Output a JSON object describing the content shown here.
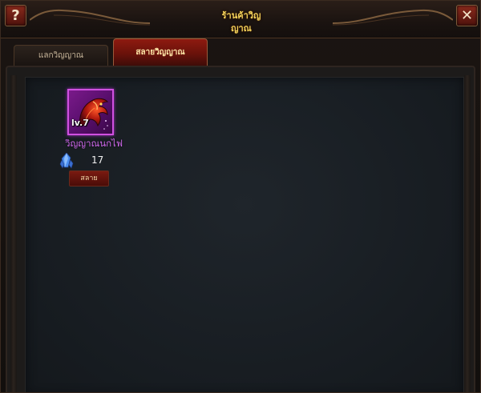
{
  "window": {
    "title_line1": "ร้านค้าวิญ",
    "title_line2": "ญาณ"
  },
  "buttons": {
    "help_icon": "help-icon",
    "help_glyph": "?",
    "close_icon": "close-icon",
    "close_glyph": "✕"
  },
  "tabs": [
    {
      "label": "แลกวิญญาณ",
      "active": false
    },
    {
      "label": "สลายวิญญาณ",
      "active": true
    }
  ],
  "items": [
    {
      "icon": "fire-bird-icon",
      "level": "lv.7",
      "name": "วิญญาณนกไฟ",
      "currency_icon": "blue-crystal-icon",
      "count": "17",
      "action_label": "สลาย"
    }
  ],
  "colors": {
    "title": "#f2d15a",
    "item_name": "#d46cf2",
    "active_tab": "#8e1a10",
    "item_border": "#d050e0"
  }
}
